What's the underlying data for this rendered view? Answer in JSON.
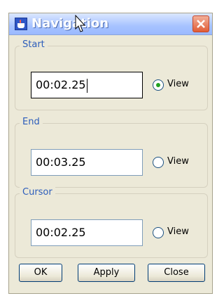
{
  "window": {
    "title": "Navigation",
    "icon": "java-app-icon",
    "close_icon": "close-icon"
  },
  "groups": [
    {
      "label": "Start",
      "value": "00:02.25",
      "radio_label": "View",
      "radio_selected": true
    },
    {
      "label": "End",
      "value": "00:03.25",
      "radio_label": "View",
      "radio_selected": false
    },
    {
      "label": "Cursor",
      "value": "00:02.25",
      "radio_label": "View",
      "radio_selected": false
    }
  ],
  "buttons": {
    "ok": "OK",
    "apply": "Apply",
    "close": "Close"
  },
  "colors": {
    "title_text": "#ffffff",
    "group_label": "#2c5dbb",
    "radio_selected": "#21a121",
    "close_button": "#e15c36"
  }
}
